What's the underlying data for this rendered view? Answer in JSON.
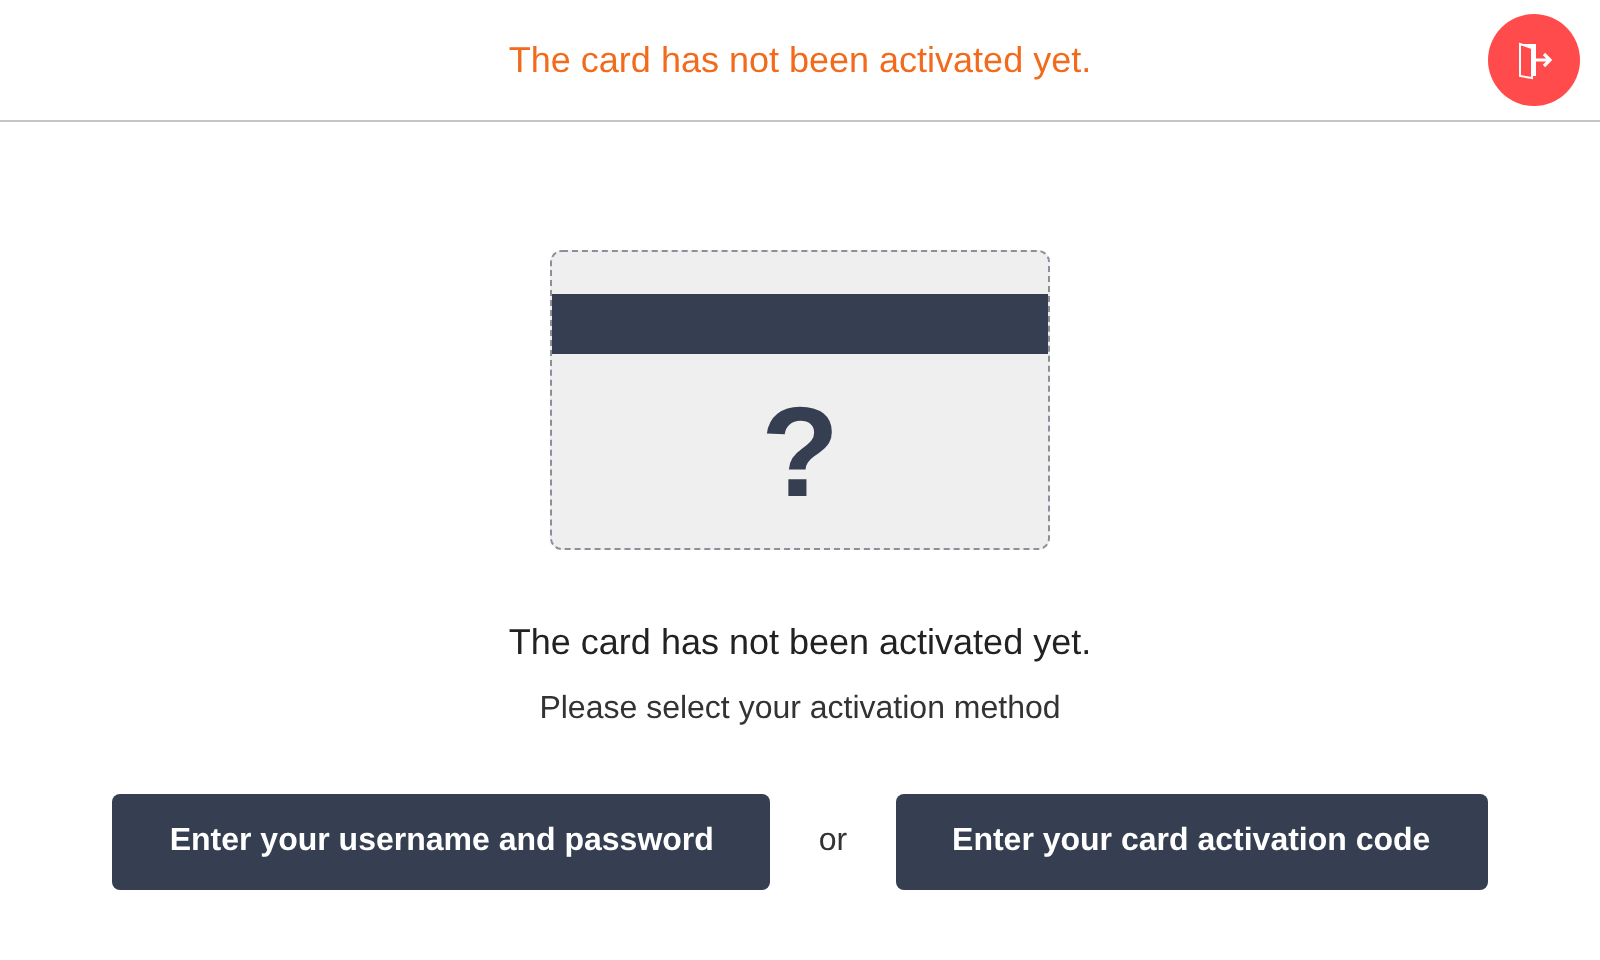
{
  "header": {
    "title": "The card has not been activated yet."
  },
  "card": {
    "symbol": "?"
  },
  "message": {
    "heading": "The card has not been activated yet.",
    "subtitle": "Please select your activation method"
  },
  "actions": {
    "buttons": [
      "Enter your username and password",
      "Enter your card activation code"
    ],
    "separator": "or"
  }
}
